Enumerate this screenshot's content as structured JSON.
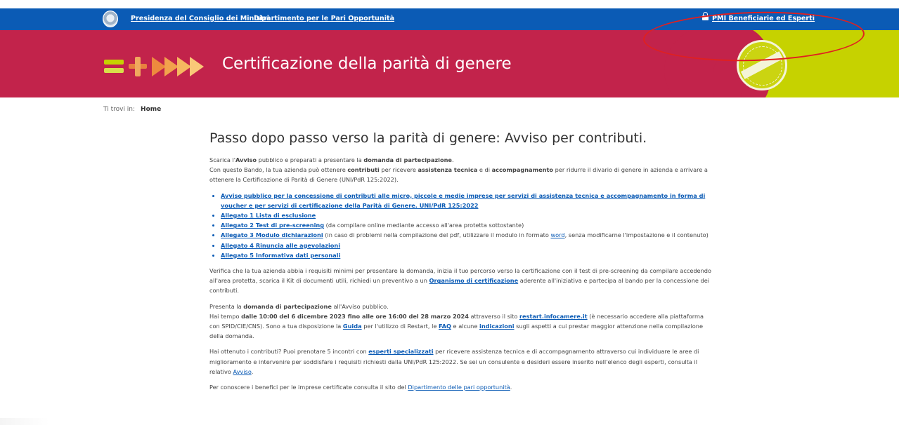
{
  "topbar": {
    "link_presidenza": "Presidenza del Consiglio dei Ministri",
    "link_dipartimento": "Dipartimento per le Pari Opportunità",
    "login_label": "PMI Beneficiarie ed Esperti"
  },
  "banner": {
    "title": "Certificazione della parità di genere"
  },
  "breadcrumb": {
    "prefix": "Ti trovi in:",
    "home": "Home"
  },
  "main": {
    "heading": "Passo dopo passo verso la parità di genere: Avviso per contributi.",
    "intro": {
      "p1_a": "Scarica l'",
      "p1_b": "Avviso",
      "p1_c": " pubblico e preparati a presentare la ",
      "p1_d": "domanda di partecipazione",
      "p1_e": ".",
      "p2_a": "Con questo Bando, la tua azienda può ottenere ",
      "p2_b": "contributi",
      "p2_c": " per ricevere ",
      "p2_d": "assistenza tecnica",
      "p2_e": " e di ",
      "p2_f": "accompagnamento",
      "p2_g": " per ridurre il divario di genere in azienda e arrivare a ottenere la Certificazione di Parità di Genere (UNI/PdR 125:2022)."
    },
    "documents": [
      {
        "link": "Avviso pubblico per la concessione di contributi alle micro, piccole e medie imprese per servizi di assistenza tecnica e accompagnamento in forma di voucher e per servizi di certificazione della Parità di Genere. UNI/PdR 125:2022",
        "note": ""
      },
      {
        "link": "Allegato 1 Lista di esclusione",
        "note": ""
      },
      {
        "link": "Allegato 2 Test di pre-screening",
        "note": " (da compilare online mediante accesso all'area protetta sottostante)"
      },
      {
        "link": "Allegato 3 Modulo dichiarazioni",
        "note": " (in caso di problemi nella compilazione del pdf, utilizzare il modulo in formato ",
        "link2": "word",
        "note2": ", senza modificarne l'impostazione e il contenuto)"
      },
      {
        "link": "Allegato 4 Rinuncia alle agevolazioni",
        "note": ""
      },
      {
        "link": "Allegato 5 Informativa dati personali",
        "note": ""
      }
    ],
    "verify": {
      "a": "Verifica che la tua azienda abbia i requisiti minimi per presentare la domanda, inizia il tuo percorso verso la certificazione con il test di pre-screening da compilare accedendo all'area protetta, scarica il Kit di documenti utili, richiedi un preventivo a un ",
      "link": "Organismo di certificazione",
      "b": " aderente all'iniziativa e partecipa al bando per la concessione dei contributi."
    },
    "apply": {
      "a": "Presenta la ",
      "b": "domanda di partecipazione",
      "c": " all'Avviso pubblico.",
      "d": "Hai tempo ",
      "e": "dalle 10:00 del 6 dicembre 2023 fino alle ore 16:00 del 28 marzo 2024",
      "f": " attraverso il sito ",
      "link_restart": "restart.infocamere.it",
      "g": " (è necessario accedere alla piattaforma con SPID/CIE/CNS). Sono a tua disposizione la ",
      "link_guida": "Guida",
      "h": " per l'utilizzo di Restart, le ",
      "link_faq": "FAQ",
      "i": " e alcune ",
      "link_indicazioni": "indicazioni",
      "j": " sugli aspetti a cui prestar maggior attenzione nella compilazione della domanda."
    },
    "experts": {
      "a": "Hai ottenuto i contributi? Puoi prenotare 5 incontri con ",
      "link": "esperti specializzati",
      "b": " per ricevere assistenza tecnica e di accompagnamento attraverso cui individuare le aree di miglioramento e intervenire per soddisfare i requisiti richiesti dalla UNI/PdR 125:2022. Se sei un consulente e desideri essere inserito nell'elenco degli esperti, consulta il relativo ",
      "link2": "Avviso",
      "c": "."
    },
    "benefits": {
      "a": "Per conoscere i benefici per le imprese certificate consulta il sito del ",
      "link": "Dipartimento delle pari opportunità",
      "b": "."
    }
  },
  "colors": {
    "topbar": "#0b5bb5",
    "banner": "#c2234b",
    "lime": "#c6d200",
    "annotation": "#e02020"
  },
  "icons": {
    "emblem": "government-emblem-icon",
    "lock": "lock-icon",
    "seal": "certification-seal-icon"
  }
}
